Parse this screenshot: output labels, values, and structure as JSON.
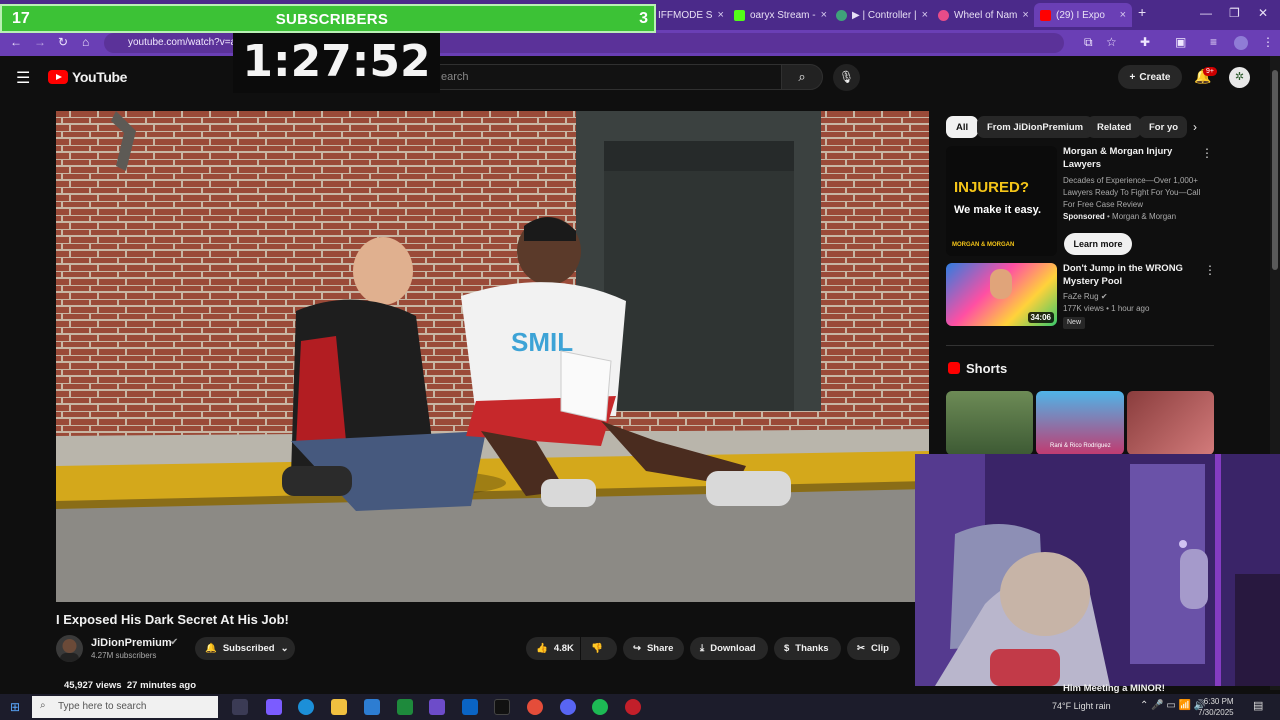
{
  "browser": {
    "tabs": [
      {
        "label": "IFFMODE S",
        "color": "#d23f3f"
      },
      {
        "label": "oaryx Stream -",
        "color": "#53fc18"
      },
      {
        "label": "▶ | Controller |",
        "color": "#3fa37a"
      },
      {
        "label": "Wheel of Nam",
        "color": "#e84c89"
      },
      {
        "label": "(29) I Expo",
        "color": "#ff0000"
      }
    ],
    "new_tab": "+",
    "url": "youtube.com/watch?v=a"
  },
  "overlay": {
    "sub_left": "17",
    "sub_title": "SUBSCRIBERS",
    "sub_right": "3",
    "timer": "1:27:52"
  },
  "yt": {
    "logo_text": "YouTube",
    "search_placeholder": "earch",
    "create_label": "Create",
    "notif_badge": "9+"
  },
  "video": {
    "title": "I Exposed His Dark Secret At His Job!",
    "channel": "JiDionPremium",
    "subscribers": "4.27M subscribers",
    "subscribed_label": "Subscribed",
    "likes": "4.8K",
    "share_label": "Share",
    "download_label": "Download",
    "thanks_label": "Thanks",
    "clip_label": "Clip",
    "views": "45,927 views",
    "age": "27 minutes ago"
  },
  "sidebar": {
    "chips": [
      "All",
      "From JiDionPremium",
      "Related",
      "For yo"
    ],
    "ad": {
      "title": "Morgan & Morgan Injury Lawyers",
      "desc": "Decades of Experience—Over 1,000+ Lawyers Ready To Fight For You—Call For Free Case Review",
      "sponsored": "Sponsored",
      "advertiser": "Morgan & Morgan",
      "cta": "Learn more",
      "thumb_top": "INJURED?",
      "thumb_main": "We make it easy.",
      "thumb_brand": "MORGAN & MORGAN"
    },
    "rec": {
      "title": "Don't Jump in the WRONG Mystery Pool",
      "channel": "FaZe Rug",
      "meta": "177K views • 1 hour ago",
      "badge": "New",
      "duration": "34:06"
    },
    "shorts_title": "Shorts",
    "shorts_caption": "Rani & Rico Rodriguez",
    "bottom_title": "Him Meeting a MINOR!"
  },
  "taskbar": {
    "search_placeholder": "Type here to search",
    "weather": "74°F  Light rain",
    "time": "6:30 PM",
    "date": "7/30/2025"
  },
  "colors": {
    "tabstrip": "#4b2a8a",
    "toolbar": "#6a3fb5",
    "subbar": "#3cc236",
    "yt_bg": "#0f0f0f",
    "yt_red": "#ff0000"
  }
}
